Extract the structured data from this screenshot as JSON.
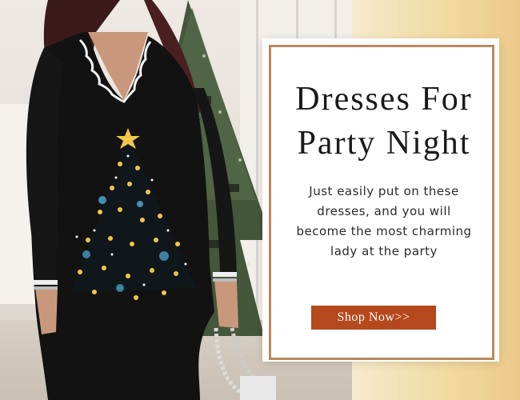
{
  "banner": {
    "title_lines": [
      "Dresses For",
      "Party Night"
    ],
    "description_lines": [
      "Just easily put on these",
      "dresses, and you will",
      "become the most charming",
      "lady at the party"
    ],
    "cta_label": "Shop Now>>"
  },
  "colors": {
    "accent": "#b5491d",
    "frame": "#b98a5e",
    "gold_background": "#f1d9a0",
    "dress": "#121212"
  },
  "image": {
    "subject": "woman-in-black-christmas-tree-print-dress",
    "icons": [
      "christmas-tree-print",
      "handbag",
      "bracelet",
      "christmas-tree"
    ]
  }
}
